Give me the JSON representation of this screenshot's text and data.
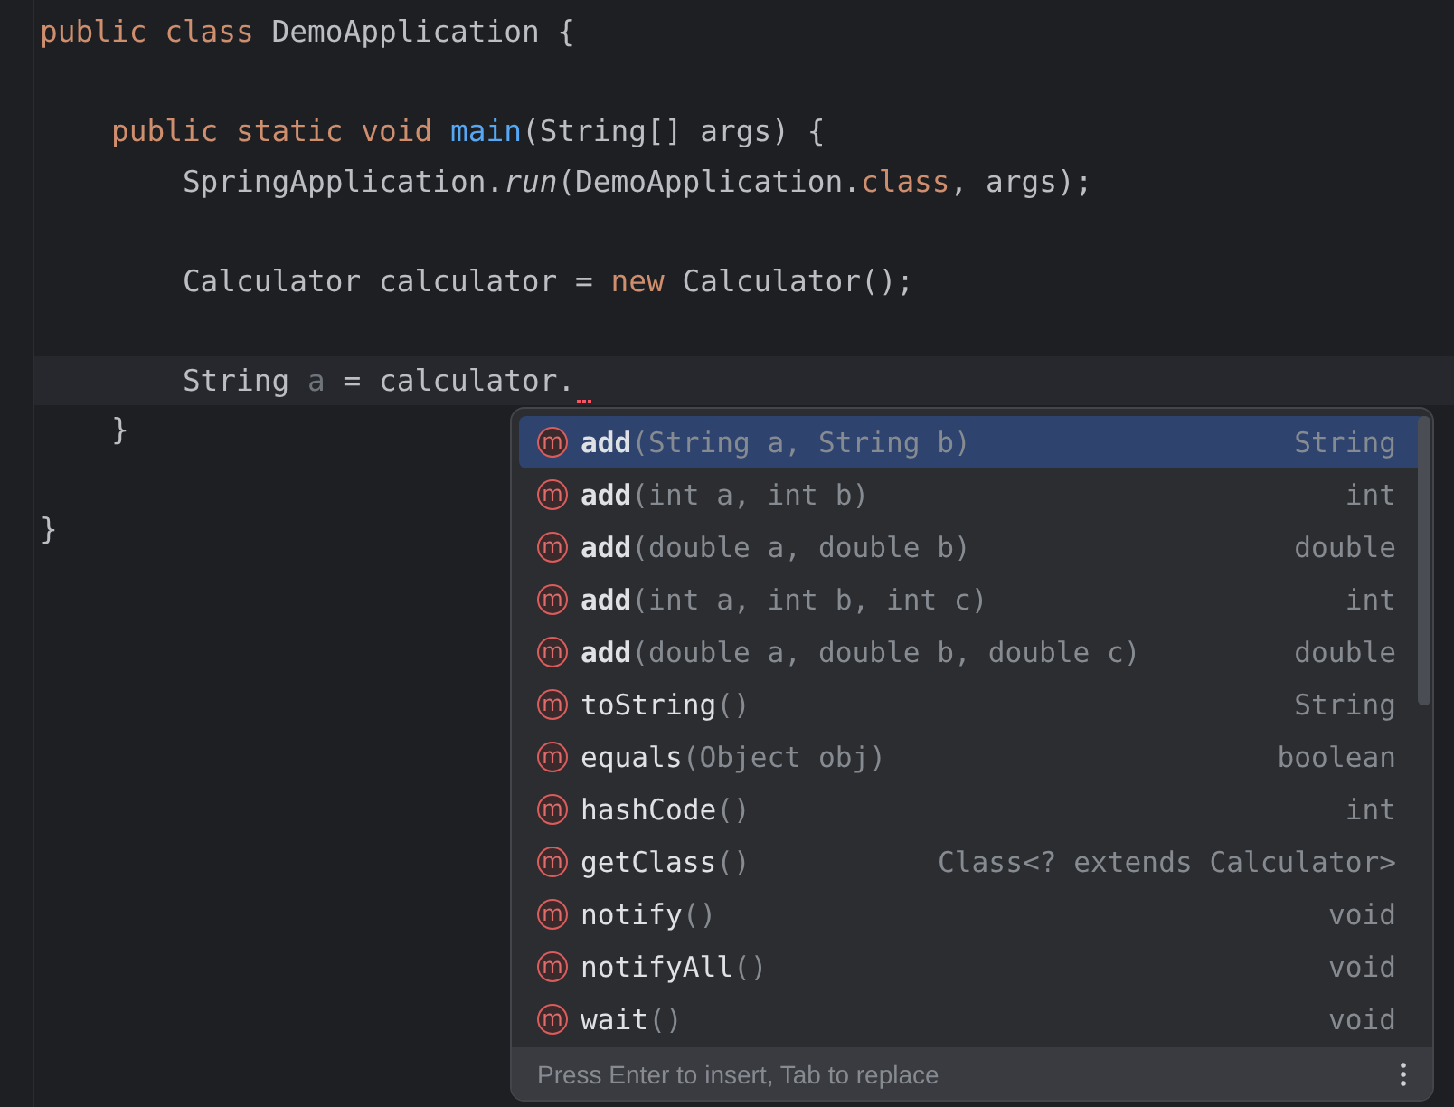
{
  "editor": {
    "lines": [
      {
        "kind": "code",
        "tokens": [
          {
            "kind": "keyword",
            "text": "public class "
          },
          {
            "kind": "plain",
            "text": "DemoApplication {"
          }
        ]
      },
      {
        "kind": "blank"
      },
      {
        "kind": "code",
        "tokens": [
          {
            "kind": "keyword",
            "text": "    public static void "
          },
          {
            "kind": "declaration",
            "text": "main"
          },
          {
            "kind": "plain",
            "text": "(String[] args) {"
          }
        ]
      },
      {
        "kind": "code",
        "tokens": [
          {
            "kind": "plain",
            "text": "        SpringApplication."
          },
          {
            "kind": "static-call",
            "text": "run"
          },
          {
            "kind": "plain",
            "text": "(DemoApplication."
          },
          {
            "kind": "keyword",
            "text": "class"
          },
          {
            "kind": "plain",
            "text": ", args);"
          }
        ]
      },
      {
        "kind": "blank"
      },
      {
        "kind": "code",
        "tokens": [
          {
            "kind": "plain",
            "text": "        Calculator calculator = "
          },
          {
            "kind": "keyword",
            "text": "new "
          },
          {
            "kind": "plain",
            "text": "Calculator();"
          }
        ]
      },
      {
        "kind": "blank"
      },
      {
        "kind": "code",
        "current": true,
        "error_after": true,
        "tokens": [
          {
            "kind": "plain",
            "text": "        String "
          },
          {
            "kind": "unused",
            "text": "a"
          },
          {
            "kind": "plain",
            "text": " = calculator."
          }
        ]
      },
      {
        "kind": "code",
        "tokens": [
          {
            "kind": "plain",
            "text": "    }"
          }
        ]
      },
      {
        "kind": "blank"
      },
      {
        "kind": "code",
        "tokens": [
          {
            "kind": "plain",
            "text": "}"
          }
        ]
      }
    ]
  },
  "completion_popup": {
    "items": [
      {
        "icon_letter": "m",
        "name": "add",
        "params": "(String a, String b)",
        "type": "String",
        "emphasized": true,
        "selected": true
      },
      {
        "icon_letter": "m",
        "name": "add",
        "params": "(int a, int b)",
        "type": "int",
        "emphasized": true,
        "selected": false
      },
      {
        "icon_letter": "m",
        "name": "add",
        "params": "(double a, double b)",
        "type": "double",
        "emphasized": true,
        "selected": false
      },
      {
        "icon_letter": "m",
        "name": "add",
        "params": "(int a, int b, int c)",
        "type": "int",
        "emphasized": true,
        "selected": false
      },
      {
        "icon_letter": "m",
        "name": "add",
        "params": "(double a, double b, double c)",
        "type": "double",
        "emphasized": true,
        "selected": false
      },
      {
        "icon_letter": "m",
        "name": "toString",
        "params": "()",
        "type": "String",
        "emphasized": false,
        "selected": false
      },
      {
        "icon_letter": "m",
        "name": "equals",
        "params": "(Object obj)",
        "type": "boolean",
        "emphasized": false,
        "selected": false
      },
      {
        "icon_letter": "m",
        "name": "hashCode",
        "params": "()",
        "type": "int",
        "emphasized": false,
        "selected": false
      },
      {
        "icon_letter": "m",
        "name": "getClass",
        "params": "()",
        "type": "Class<? extends Calculator>",
        "emphasized": false,
        "selected": false
      },
      {
        "icon_letter": "m",
        "name": "notify",
        "params": "()",
        "type": "void",
        "emphasized": false,
        "selected": false
      },
      {
        "icon_letter": "m",
        "name": "notifyAll",
        "params": "()",
        "type": "void",
        "emphasized": false,
        "selected": false
      },
      {
        "icon_letter": "m",
        "name": "wait",
        "params": "()",
        "type": "void",
        "emphasized": false,
        "selected": false
      }
    ],
    "footer_hint": "Press Enter to insert, Tab to replace"
  }
}
